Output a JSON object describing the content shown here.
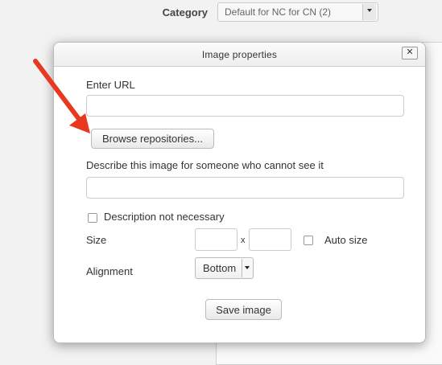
{
  "background": {
    "category_label": "Category",
    "category_value": "Default for NC for CN (2)"
  },
  "dialog": {
    "title": "Image properties",
    "close_glyph": "✕",
    "url_label": "Enter URL",
    "url_value": "",
    "browse_label": "Browse repositories...",
    "describe_label": "Describe this image for someone who cannot see it",
    "describe_value": "",
    "desc_not_necessary_label": "Description not necessary",
    "size_label": "Size",
    "size_separator": "x",
    "auto_size_label": "Auto size",
    "alignment_label": "Alignment",
    "alignment_value": "Bottom",
    "save_label": "Save image"
  },
  "colors": {
    "annotation_arrow": "#e8381f"
  }
}
